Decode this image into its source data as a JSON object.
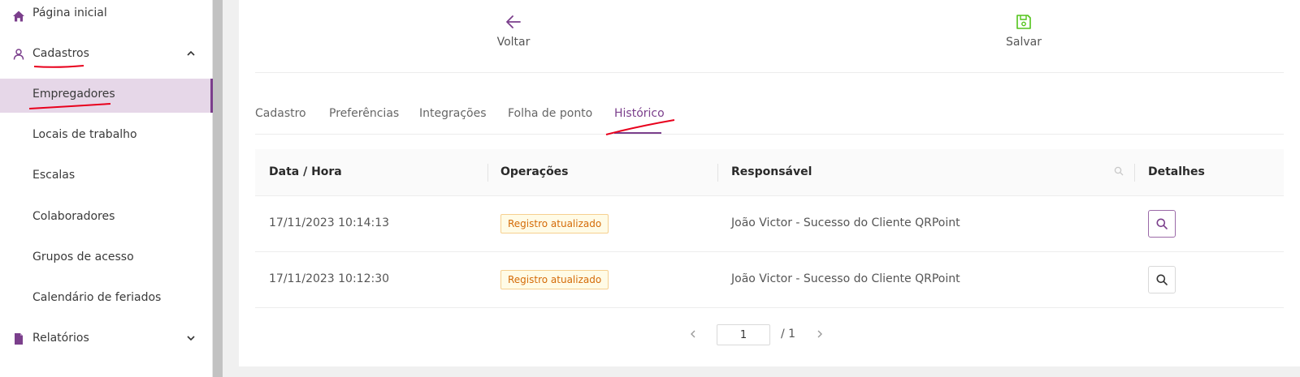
{
  "sidebar": {
    "items": [
      {
        "label": "Página inicial",
        "icon": "home-icon"
      },
      {
        "label": "Cadastros",
        "icon": "user-icon",
        "expanded": true
      },
      {
        "label": "Empregadores",
        "active": true
      },
      {
        "label": "Locais de trabalho"
      },
      {
        "label": "Escalas"
      },
      {
        "label": "Colaboradores"
      },
      {
        "label": "Grupos de acesso"
      },
      {
        "label": "Calendário de feriados"
      },
      {
        "label": "Relatórios",
        "icon": "report-icon",
        "expanded": false
      }
    ]
  },
  "actions": {
    "back_label": "Voltar",
    "save_label": "Salvar"
  },
  "tabs": [
    {
      "label": "Cadastro"
    },
    {
      "label": "Preferências"
    },
    {
      "label": "Integrações"
    },
    {
      "label": "Folha de ponto"
    },
    {
      "label": "Histórico",
      "active": true
    }
  ],
  "table": {
    "headers": {
      "datetime": "Data / Hora",
      "operations": "Operações",
      "responsible": "Responsável",
      "details": "Detalhes"
    },
    "rows": [
      {
        "datetime": "17/11/2023 10:14:13",
        "operation": "Registro atualizado",
        "responsible": "João Victor - Sucesso do Cliente QRPoint"
      },
      {
        "datetime": "17/11/2023 10:12:30",
        "operation": "Registro atualizado",
        "responsible": "João Victor - Sucesso do Cliente QRPoint"
      }
    ]
  },
  "pagination": {
    "current": "1",
    "total": "/ 1"
  },
  "colors": {
    "accent": "#7b3f8c",
    "save_icon": "#52c41a",
    "badge_text": "#d46b08",
    "annotation": "#e8001c"
  }
}
